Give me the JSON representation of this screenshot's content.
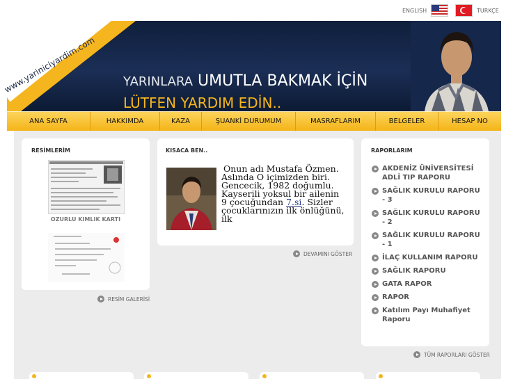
{
  "languages": {
    "english": "ENGLISH",
    "turkish": "TURKÇE"
  },
  "banner": {
    "site_url": "www.yariniciyardim.com",
    "line1_part1": "YARINLARA",
    "line1_part2": "UMUTLA BAKMAK İÇİN",
    "line2": "LÜTFEN YARDIM EDİN.."
  },
  "nav": [
    "ANA SAYFA",
    "HAKKIMDA",
    "KAZA",
    "ŞUANKİ DURUMUM",
    "MASRAFLARIM",
    "BELGELER",
    "HESAP NO"
  ],
  "photos": {
    "title": "RESİMLERİM",
    "caption1": "OZURLU KIMLIK KARTI",
    "gallery_link": "RESİM GALERİSİ"
  },
  "about": {
    "title": "KISACA BEN..",
    "text_before": "Onun adı Mustafa Özmen. Aslında O içimizden biri. Gencecik, 1982 doğumlu. Kayserili yoksul bir ailenin 9 çocuğundan ",
    "text_link": "7.si",
    "text_after": ". Sizler çocuklarınızın ilk önlüğünü, ilk",
    "more_link": "DEVAMINI GÖSTER"
  },
  "reports": {
    "title": "RAPORLARIM",
    "items": [
      "AKDENİZ ÜNİVERSİTESİ ADLİ TIP RAPORU",
      "SAĞLIK KURULU RAPORU - 3",
      "SAĞLIK KURULU RAPORU - 2",
      "SAĞLIK KURULU RAPORU - 1",
      "İLAÇ KULLANIM RAPORU",
      "SAĞLIK RAPORU",
      "GATA RAPOR",
      "RAPOR",
      "Katılım Payı Muhafiyet Raporu"
    ],
    "all_link": "TÜM RAPORLARI GÖSTER"
  },
  "colors": {
    "accent": "#f5b51e",
    "banner": "#13264a"
  }
}
